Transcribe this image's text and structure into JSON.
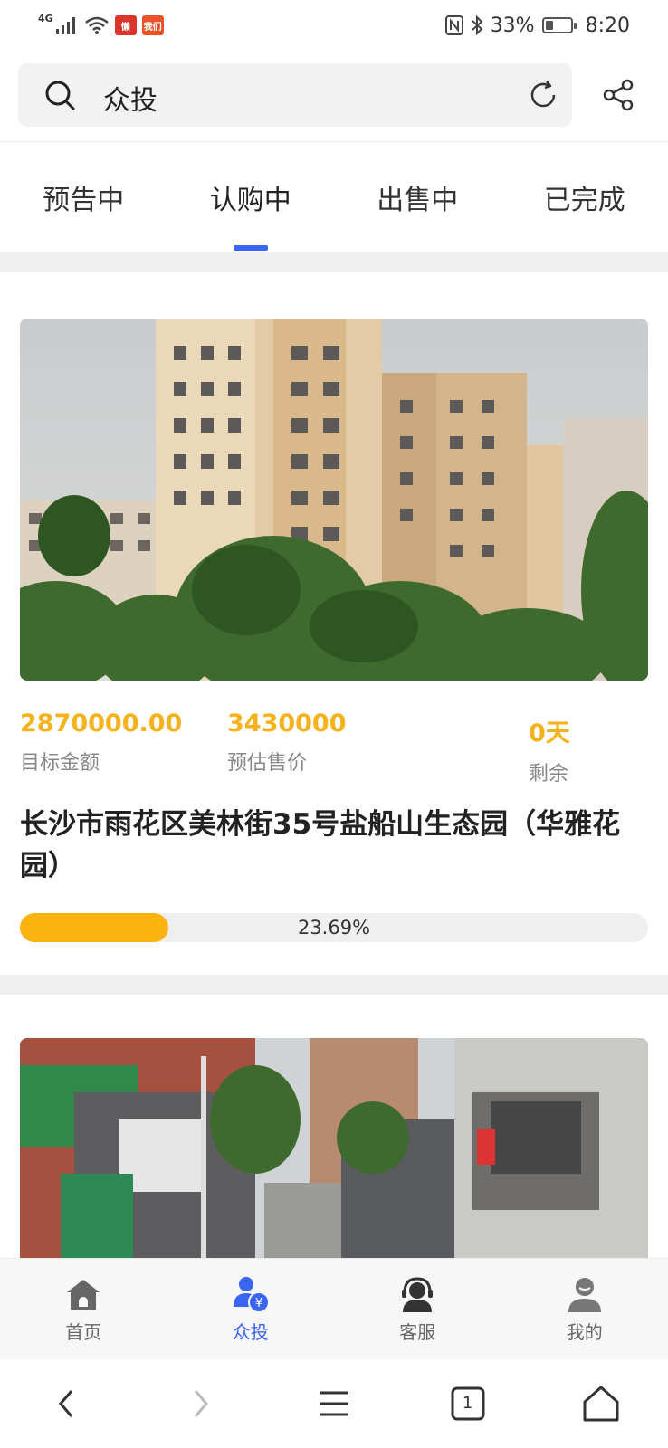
{
  "status_bar": {
    "network": "4G",
    "battery_percent": "33%",
    "time": "8:20",
    "battery_level": 0.33,
    "app_badge_1": "懒",
    "app_badge_2": "我们"
  },
  "search": {
    "query": "众投"
  },
  "tabs": [
    {
      "label": "预告中"
    },
    {
      "label": "认购中"
    },
    {
      "label": "出售中"
    },
    {
      "label": "已完成"
    }
  ],
  "active_tab": 1,
  "listing_1": {
    "target_amount": "2870000.00",
    "target_amount_label": "目标金额",
    "estimated_price": "3430000",
    "estimated_price_label": "预估售价",
    "days_remaining": "0天",
    "days_remaining_label": "剩余",
    "title": "长沙市雨花区美林街35号盐船山生态园（华雅花园）",
    "progress_text": "23.69%",
    "progress_fraction": 0.2369
  },
  "bottom_nav": [
    {
      "label": "首页",
      "icon": "home-icon"
    },
    {
      "label": "众投",
      "icon": "crowd-invest-icon"
    },
    {
      "label": "客服",
      "icon": "customer-service-icon"
    },
    {
      "label": "我的",
      "icon": "profile-icon"
    }
  ],
  "system_bar": {
    "tab_count": "1"
  },
  "colors": {
    "accent_blue": "#3b65f3",
    "highlight_yellow": "#f5b21c",
    "progress_fill": "#fbb30f"
  }
}
